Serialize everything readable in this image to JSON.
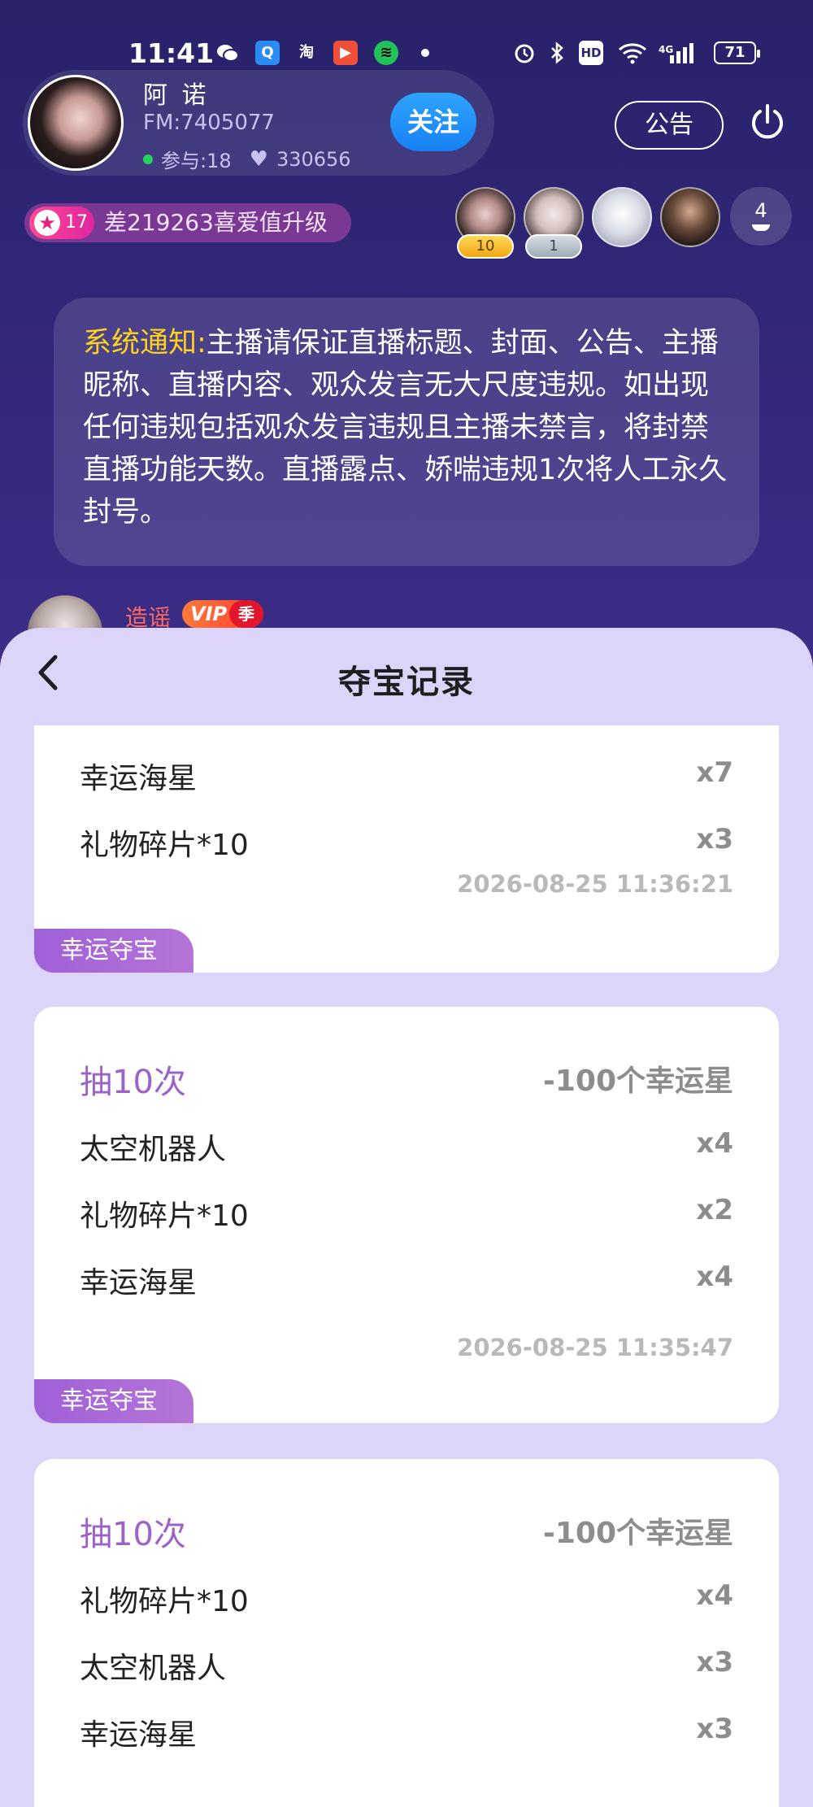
{
  "status_bar": {
    "time": "11:41",
    "battery": "71",
    "network": "4G",
    "hd": "HD"
  },
  "host": {
    "name": "阿 诺",
    "fm": "FM:7405077",
    "participants": "参与:18",
    "likes": "330656",
    "follow_label": "关注",
    "notice_label": "公告"
  },
  "level": {
    "level": "17",
    "upgrade_text": "差219263喜爱值升级"
  },
  "audience": {
    "badges": [
      "10",
      "1"
    ],
    "count": "4"
  },
  "system_notice": {
    "label": "系统通知:",
    "text": "主播请保证直播标题、封面、公告、主播昵称、直播内容、观众发言无大尺度违规。如出现任何违规包括观众发言违规且主播未禁言，将封禁直播功能天数。直播露点、娇喘违规1次将人工永久封号。"
  },
  "chat": {
    "username": "造谣",
    "vip_label": "VIP",
    "vip_season": "季"
  },
  "sheet": {
    "title": "夺宝记录",
    "records": [
      {
        "items": [
          {
            "name": "幸运海星",
            "qty": "x7"
          },
          {
            "name": "礼物碎片*10",
            "qty": "x3"
          }
        ],
        "timestamp": "2026-08-25 11:36:21",
        "tag": "幸运夺宝"
      },
      {
        "draw_label": "抽10次",
        "cost": "-100个幸运星",
        "items": [
          {
            "name": "太空机器人",
            "qty": "x4"
          },
          {
            "name": "礼物碎片*10",
            "qty": "x2"
          },
          {
            "name": "幸运海星",
            "qty": "x4"
          }
        ],
        "timestamp": "2026-08-25 11:35:47",
        "tag": "幸运夺宝"
      },
      {
        "draw_label": "抽10次",
        "cost": "-100个幸运星",
        "items": [
          {
            "name": "礼物碎片*10",
            "qty": "x4"
          },
          {
            "name": "太空机器人",
            "qty": "x3"
          },
          {
            "name": "幸运海星",
            "qty": "x3"
          }
        ]
      }
    ]
  }
}
